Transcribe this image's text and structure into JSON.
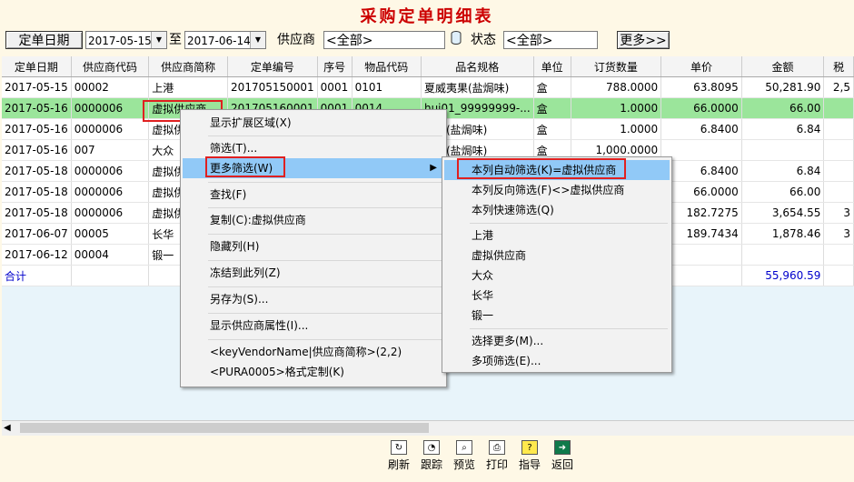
{
  "title": "采购定单明细表",
  "filter": {
    "date_button": "定单日期",
    "date_from": "2017-05-15",
    "to_label": "至",
    "date_to": "2017-06-14",
    "vendor_label": "供应商",
    "vendor_value": "<全部>",
    "status_label": "状态",
    "status_value": "<全部>",
    "more_button": "更多>>"
  },
  "table": {
    "headers": [
      "定单日期",
      "供应商代码",
      "供应商简称",
      "定单编号",
      "序号",
      "物品代码",
      "品名规格",
      "单位",
      "订货数量",
      "单价",
      "金额",
      "税"
    ],
    "rows": [
      [
        "2017-05-15",
        "00002",
        "上港",
        "201705150001",
        "0001",
        "0101",
        "夏威夷果(盐焗味)",
        "盒",
        "788.0000",
        "63.8095",
        "50,281.90",
        "2,5"
      ],
      [
        "2017-05-16",
        "0000006",
        "虚拟供应商",
        "201705160001",
        "0001",
        "0014",
        "hui01_99999999-...",
        "盒",
        "1.0000",
        "66.0000",
        "66.00",
        ""
      ],
      [
        "2017-05-16",
        "0000006",
        "虚拟供",
        "",
        "",
        "",
        "夷果(盐焗味)",
        "盒",
        "1.0000",
        "6.8400",
        "6.84",
        ""
      ],
      [
        "2017-05-16",
        "007",
        "大众",
        "",
        "",
        "",
        "夷果(盐焗味)",
        "盒",
        "1,000.0000",
        "",
        "",
        ""
      ],
      [
        "2017-05-18",
        "0000006",
        "虚拟供",
        "",
        "",
        "",
        "",
        "",
        "",
        "6.8400",
        "6.84",
        ""
      ],
      [
        "2017-05-18",
        "0000006",
        "虚拟供",
        "",
        "",
        "",
        "",
        "",
        "",
        "66.0000",
        "66.00",
        ""
      ],
      [
        "2017-05-18",
        "0000006",
        "虚拟供",
        "",
        "",
        "",
        "",
        "",
        "",
        "182.7275",
        "3,654.55",
        "3"
      ],
      [
        "2017-06-07",
        "00005",
        "长华",
        "",
        "",
        "",
        "",
        "",
        "",
        "189.7434",
        "1,878.46",
        "3"
      ],
      [
        "2017-06-12",
        "00004",
        "锻一",
        "",
        "",
        "",
        "",
        "",
        "",
        "",
        "",
        ""
      ]
    ],
    "total_label": "合计",
    "total_amount": "55,960.59"
  },
  "context_menu": [
    "显示扩展区域(X)",
    "筛选(T)...",
    "更多筛选(W)",
    "查找(F)",
    "复制(C):虚拟供应商",
    "隐藏列(H)",
    "冻结到此列(Z)",
    "另存为(S)...",
    "显示供应商属性(I)...",
    "<keyVendorName|供应商简称>(2,2)",
    "<PURA0005>格式定制(K)"
  ],
  "submenu": [
    "本列自动筛选(K)=虚拟供应商",
    "本列反向筛选(F)<>虚拟供应商",
    "本列快速筛选(Q)",
    "上港",
    "虚拟供应商",
    "大众",
    "长华",
    "锻一",
    "选择更多(M)...",
    "多项筛选(E)..."
  ],
  "toolbar": [
    "刷新",
    "跟踪",
    "预览",
    "打印",
    "指导",
    "返回"
  ],
  "colors": {
    "selected_row": "#9be59b",
    "menu_highlight": "#91c9f7",
    "title": "#cc0000",
    "total": "#0000cc"
  }
}
